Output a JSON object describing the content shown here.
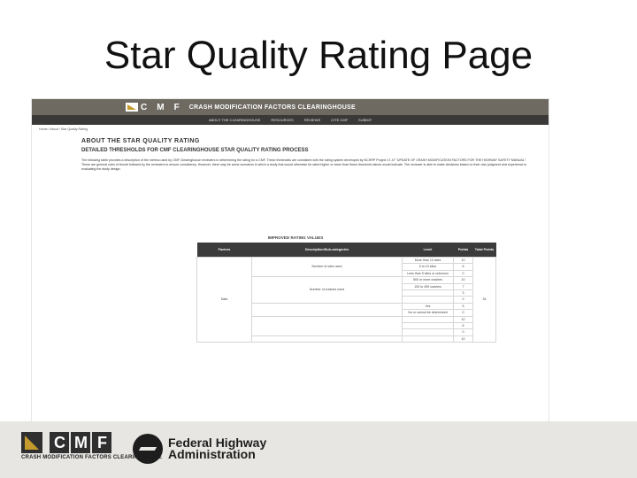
{
  "slide": {
    "title": "Star Quality Rating Page"
  },
  "site": {
    "logo_letters": [
      "C",
      "M",
      "F"
    ],
    "title": "CRASH MODIFICATION FACTORS CLEARINGHOUSE",
    "nav": [
      "ABOUT THE CLEARINGHOUSE",
      "RESOURCES",
      "REVIEWS",
      "CITE CMF",
      "SUBMIT"
    ],
    "breadcrumb": "Home / About / Star Quality Rating"
  },
  "content": {
    "page_heading": "ABOUT THE STAR QUALITY RATING",
    "section_heading": "DETAILED THRESHOLDS FOR CMF CLEARINGHOUSE STAR QUALITY RATING PROCESS",
    "intro_1": "The following table provides a description of the metrics used by CMF Clearinghouse reviewers in determining the rating for a CMF. These thresholds are consistent with the rating system developed by NCHRP Project 17-47 \"UPDATE OF CRASH MODIFICATION FACTORS FOR THE HIGHWAY SAFETY MANUAL\". These are general rules of thumb followed by the reviewers to ensure consistency. However, there may be some scenarios in which a study that would otherwise be rated higher or lower than these threshold values would indicate.",
    "intro_2": "The reviewer is able to make decisions based on their own judgment and experience in evaluating the study design.",
    "table_caption": "IMPROVED RATING VALUES"
  },
  "table": {
    "headers": [
      "Factors",
      "Description/Sub-categories",
      "Level",
      "Points",
      "Total Points"
    ],
    "factor": "Data",
    "total": "34",
    "rows": [
      {
        "desc": "Number of sites used",
        "level": "More than 10 sites",
        "points": "10"
      },
      {
        "desc": "",
        "level": "5 to 10 sites",
        "points": "6"
      },
      {
        "desc": "",
        "level": "Less than 5 sites or unknown",
        "points": "0"
      },
      {
        "desc": "Number of crashes used",
        "level": "500 or more crashes",
        "points": "10"
      },
      {
        "desc": "",
        "level": "100 to 499 crashes",
        "points": "7"
      },
      {
        "desc": "",
        "level": "",
        "points": "3"
      },
      {
        "desc": "",
        "level": "",
        "points": "0"
      },
      {
        "desc": "",
        "level": "Yes",
        "points": "5"
      },
      {
        "desc": "",
        "level": "No or cannot be determined",
        "points": "0"
      },
      {
        "desc": "",
        "level": "",
        "points": "10"
      },
      {
        "desc": "",
        "level": "",
        "points": "6"
      },
      {
        "desc": "",
        "level": "",
        "points": "0"
      },
      {
        "desc": "",
        "level": "",
        "points": "10"
      }
    ]
  },
  "footer": {
    "logo_letters": [
      "C",
      "M",
      "F"
    ],
    "caption": "CRASH MODIFICATION FACTORS CLEARINGHOUSE",
    "agency_line1": "Federal Highway",
    "agency_line2": "Administration"
  }
}
